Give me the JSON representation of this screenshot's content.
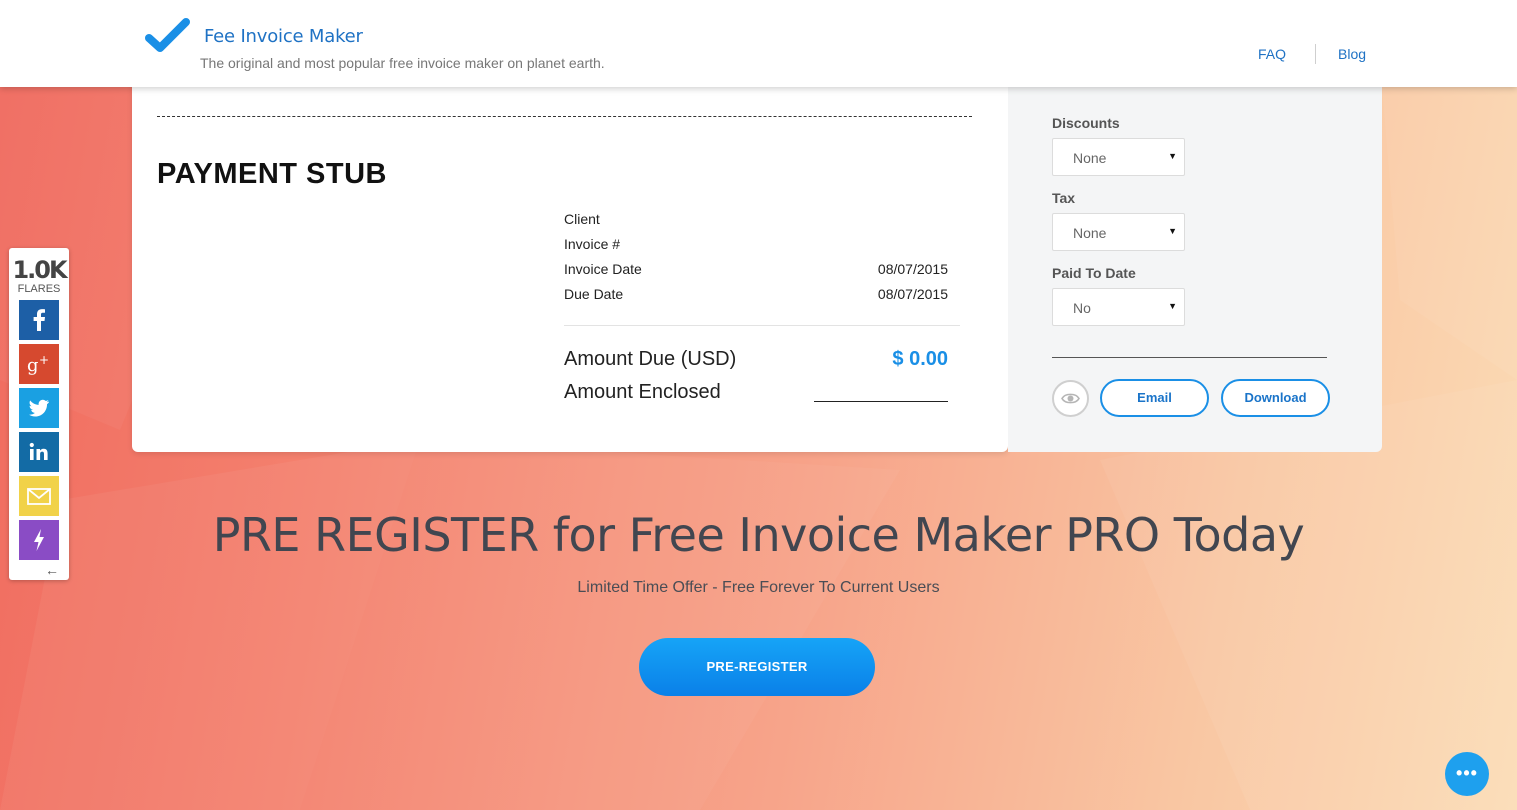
{
  "header": {
    "brand_title": "Fee Invoice Maker",
    "tagline": "The original and most popular free invoice maker on planet earth.",
    "nav": {
      "faq": "FAQ",
      "blog": "Blog"
    }
  },
  "payment_stub": {
    "title": "PAYMENT STUB",
    "rows": [
      {
        "label": "Client",
        "value": ""
      },
      {
        "label": "Invoice #",
        "value": ""
      },
      {
        "label": "Invoice Date",
        "value": "08/07/2015"
      },
      {
        "label": "Due Date",
        "value": "08/07/2015"
      }
    ],
    "amount_due_label": "Amount Due (USD)",
    "amount_due_value": "$ 0.00",
    "amount_enclosed_label": "Amount Enclosed"
  },
  "side_panel": {
    "discounts": {
      "label": "Discounts",
      "value": "None"
    },
    "tax": {
      "label": "Tax",
      "value": "None"
    },
    "paid_to_date": {
      "label": "Paid To Date",
      "value": "No"
    },
    "email_label": "Email",
    "download_label": "Download",
    "dropdown_arrow": "▼"
  },
  "share": {
    "count": "1.0K",
    "flares_label": "FLARES",
    "collapse_arrow": "←",
    "icons": [
      "facebook-icon",
      "google-plus-icon",
      "twitter-icon",
      "linkedin-icon",
      "email-icon",
      "flare-icon"
    ]
  },
  "promo": {
    "title": "PRE REGISTER for Free Invoice Maker PRO Today",
    "subtitle": "Limited Time Offer - Free Forever To Current Users",
    "button": "PRE-REGISTER"
  },
  "chat": {
    "dots": "•••"
  },
  "colors": {
    "accent": "#1a8fe6",
    "brand_blue": "#1f72c4",
    "facebook": "#1d5fa6",
    "google_plus": "#d6492f",
    "twitter": "#1aa0e2",
    "linkedin": "#136ba5",
    "email": "#f1d249",
    "flare": "#8a4cc5"
  }
}
